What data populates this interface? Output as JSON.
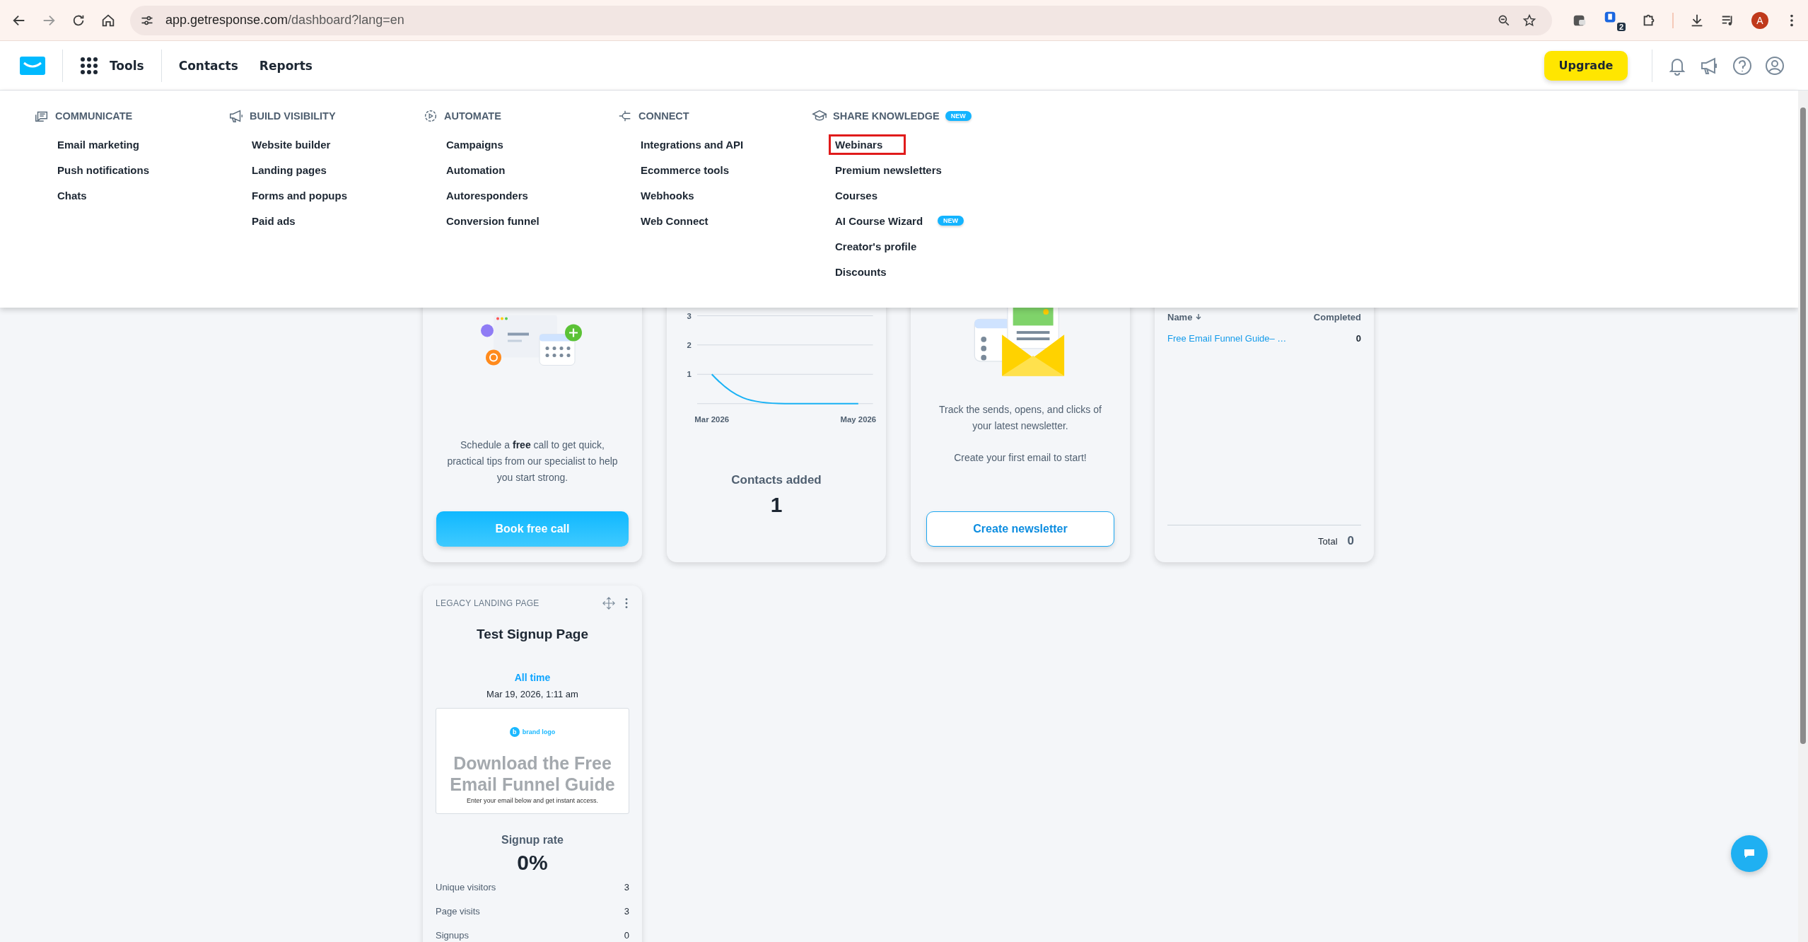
{
  "browser": {
    "url_host": "app.getresponse.com",
    "url_path": "/dashboard?lang=en",
    "extension_badge": "2",
    "profile_initial": "A"
  },
  "nav": {
    "tools": "Tools",
    "items": [
      {
        "label": "Contacts"
      },
      {
        "label": "Reports"
      }
    ],
    "upgrade": "Upgrade"
  },
  "tools_menu": {
    "columns": [
      {
        "heading": "COMMUNICATE",
        "items": [
          {
            "label": "Email marketing",
            "highlighted": false
          },
          {
            "label": "Push notifications",
            "highlighted": false
          },
          {
            "label": "Chats",
            "highlighted": false
          }
        ]
      },
      {
        "heading": "BUILD VISIBILITY",
        "items": [
          {
            "label": "Website builder",
            "highlighted": false
          },
          {
            "label": "Landing pages",
            "highlighted": false
          },
          {
            "label": "Forms and popups",
            "highlighted": false
          },
          {
            "label": "Paid ads",
            "highlighted": false
          }
        ]
      },
      {
        "heading": "AUTOMATE",
        "items": [
          {
            "label": "Campaigns",
            "highlighted": false
          },
          {
            "label": "Automation",
            "highlighted": false
          },
          {
            "label": "Autoresponders",
            "highlighted": false
          },
          {
            "label": "Conversion funnel",
            "highlighted": false
          }
        ]
      },
      {
        "heading": "CONNECT",
        "items": [
          {
            "label": "Integrations and API",
            "highlighted": false
          },
          {
            "label": "Ecommerce tools",
            "highlighted": false
          },
          {
            "label": "Webhooks",
            "highlighted": false
          },
          {
            "label": "Web Connect",
            "highlighted": false
          }
        ]
      },
      {
        "heading": "SHARE KNOWLEDGE",
        "badge": "NEW",
        "items": [
          {
            "label": "Webinars",
            "highlighted": true
          },
          {
            "label": "Premium newsletters",
            "highlighted": false
          },
          {
            "label": "Courses",
            "highlighted": false
          },
          {
            "label": "AI Course Wizard",
            "badge": "NEW",
            "highlighted": false
          },
          {
            "label": "Creator's profile",
            "highlighted": false
          },
          {
            "label": "Discounts",
            "highlighted": false
          }
        ]
      }
    ]
  },
  "cards": [
    {
      "kind": "consultation",
      "text": "Schedule a **free** call to get quick, practical tips from our specialist to help you start strong.",
      "button": "Book free call"
    },
    {
      "kind": "contacts_chart",
      "chart_data": {
        "type": "line",
        "categories": [
          "Mar 2026",
          null,
          "May 2026"
        ],
        "yticks": [
          1,
          2,
          3
        ],
        "ylim": [
          0,
          3
        ],
        "series": [
          {
            "color": "#1ab2f5",
            "values": [
              1,
              0,
              0
            ]
          }
        ]
      },
      "label": "Contacts added",
      "value": "1"
    },
    {
      "kind": "newsletter",
      "text": "Track the sends, opens, and clicks of your latest newsletter.",
      "note": "Create your first email to start!",
      "button": "Create newsletter"
    },
    {
      "kind": "funnel_table",
      "columns": [
        "Name",
        "Completed"
      ],
      "rows": [
        {
          "name": "Free Email Funnel Guide– …",
          "completed": "0"
        }
      ],
      "total_label": "Total",
      "total": "0"
    },
    {
      "kind": "landing_page",
      "label": "LEGACY LANDING PAGE",
      "title": "Test Signup Page",
      "period": "All time",
      "date": "Mar 19, 2026, 1:11 am",
      "preview": {
        "brand": "brand logo",
        "brand_initial": "b",
        "headline": "Download the Free Email Funnel Guide",
        "subtext": "Enter your email below and get instant access."
      },
      "rate_label": "Signup rate",
      "rate": "0%",
      "stats": [
        {
          "label": "Unique visitors",
          "value": "3"
        },
        {
          "label": "Page visits",
          "value": "3"
        },
        {
          "label": "Signups",
          "value": "0"
        }
      ]
    }
  ]
}
